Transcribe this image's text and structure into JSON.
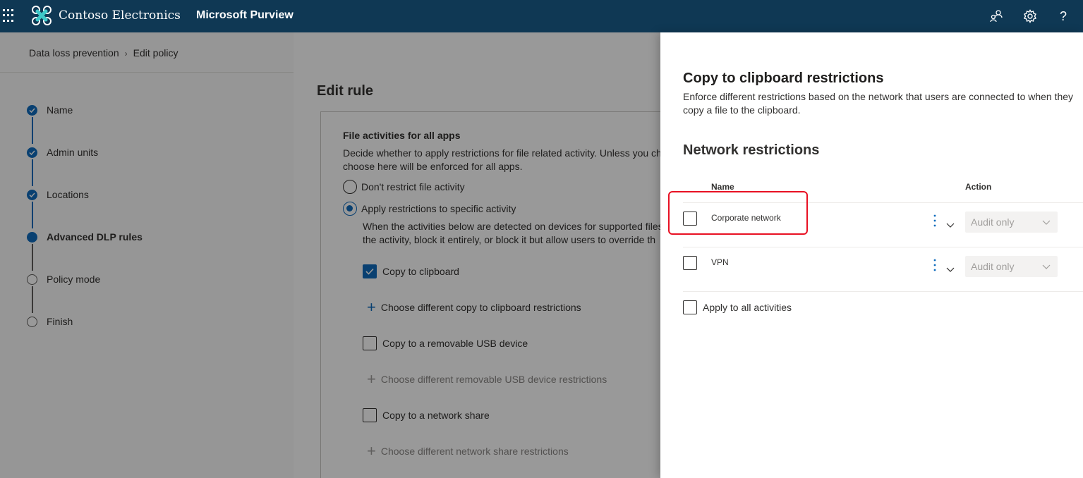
{
  "header": {
    "org_name": "Contoso Electronics",
    "app_name": "Microsoft Purview",
    "icons": [
      "waffle-icon",
      "contoso-logo",
      "people-icon",
      "gear-icon",
      "help-icon"
    ],
    "help_glyph": "?"
  },
  "breadcrumb": {
    "items": [
      "Data loss prevention",
      "Edit policy"
    ],
    "separator": "›"
  },
  "steps": [
    {
      "label": "Name",
      "state": "done"
    },
    {
      "label": "Admin units",
      "state": "done"
    },
    {
      "label": "Locations",
      "state": "done"
    },
    {
      "label": "Advanced DLP rules",
      "state": "current"
    },
    {
      "label": "Policy mode",
      "state": "todo"
    },
    {
      "label": "Finish",
      "state": "todo"
    }
  ],
  "editor": {
    "title": "Edit rule",
    "section_title": "File activities for all apps",
    "section_desc_line1": "Decide whether to apply restrictions for file related activity. Unless you ch",
    "section_desc_line2": "choose here will be enforced for all apps.",
    "radio_dont": "Don't restrict file activity",
    "radio_apply": "Apply restrictions to specific activity",
    "sub_desc_line1": "When the activities below are detected on devices for supported files",
    "sub_desc_line2": "the activity, block it entirely, or block it but allow users to override th",
    "activities": [
      {
        "label": "Copy to clipboard",
        "checked": true,
        "add_label": "Choose different copy to clipboard restrictions",
        "add_enabled": true
      },
      {
        "label": "Copy to a removable USB device",
        "checked": false,
        "add_label": "Choose different removable USB device restrictions",
        "add_enabled": false
      },
      {
        "label": "Copy to a network share",
        "checked": false,
        "add_label": "Choose different network share restrictions",
        "add_enabled": false
      }
    ]
  },
  "panel": {
    "title": "Copy to clipboard restrictions",
    "description": "Enforce different restrictions based on the network that users are connected to when they copy a file to the clipboard.",
    "network_title": "Network restrictions",
    "col_name": "Name",
    "col_action": "Action",
    "rows": [
      {
        "name": "Corporate network",
        "action": "Audit only",
        "highlighted": true
      },
      {
        "name": "VPN",
        "action": "Audit only",
        "highlighted": false
      }
    ],
    "apply_all_label": "Apply to all activities"
  },
  "colors": {
    "topbar": "#0f3854",
    "accent": "#0f6cbd",
    "highlight": "#e81123"
  }
}
